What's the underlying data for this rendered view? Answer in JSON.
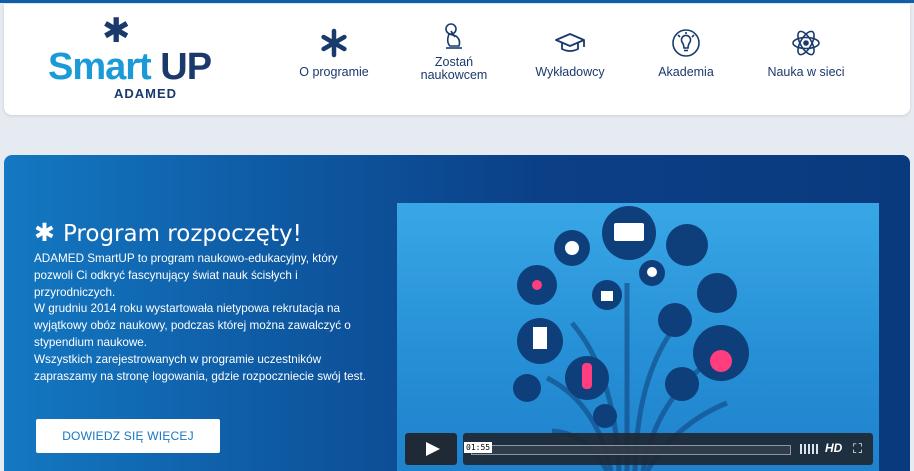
{
  "header": {
    "logo": {
      "word1": "Smart",
      "word2": "UP",
      "brand": "ADAMED"
    },
    "nav": [
      {
        "label": "O programie",
        "icon": "asterisk-icon"
      },
      {
        "label": "Zostań naukowcem",
        "icon": "thinker-icon"
      },
      {
        "label": "Wykładowcy",
        "icon": "graduation-cap-icon"
      },
      {
        "label": "Akademia",
        "icon": "lightbulb-icon"
      },
      {
        "label": "Nauka w sieci",
        "icon": "atom-icon"
      }
    ]
  },
  "hero": {
    "title": "Program rozpoczęty!",
    "paragraph1": "ADAMED SmartUP to program naukowo-edukacyjny, który pozwoli Ci odkryć fascynujący świat nauk ścisłych i przyrodniczych.",
    "paragraph2": "W grudniu 2014 roku wystartowała nietypowa rekrutacja na wyjątkowy obóz naukowy, podczas której można zawalczyć o stypendium naukowe.",
    "paragraph3": "Wszystkich zarejestrowanych w programie uczestników zapraszamy na stronę logowania, gdzie rozpoczniecie swój test.",
    "cta": "DOWIEDZ SIĘ WIĘCEJ"
  },
  "video": {
    "timecode": "01:55",
    "hd_label": "HD",
    "icons": [
      "play-icon",
      "volume-icon",
      "hd-icon",
      "fullscreen-icon"
    ]
  },
  "colors": {
    "navy": "#1a3a6c",
    "light_blue": "#1a9bd7",
    "hero_blue": "#0b3f86",
    "background": "#e6ebf2"
  }
}
